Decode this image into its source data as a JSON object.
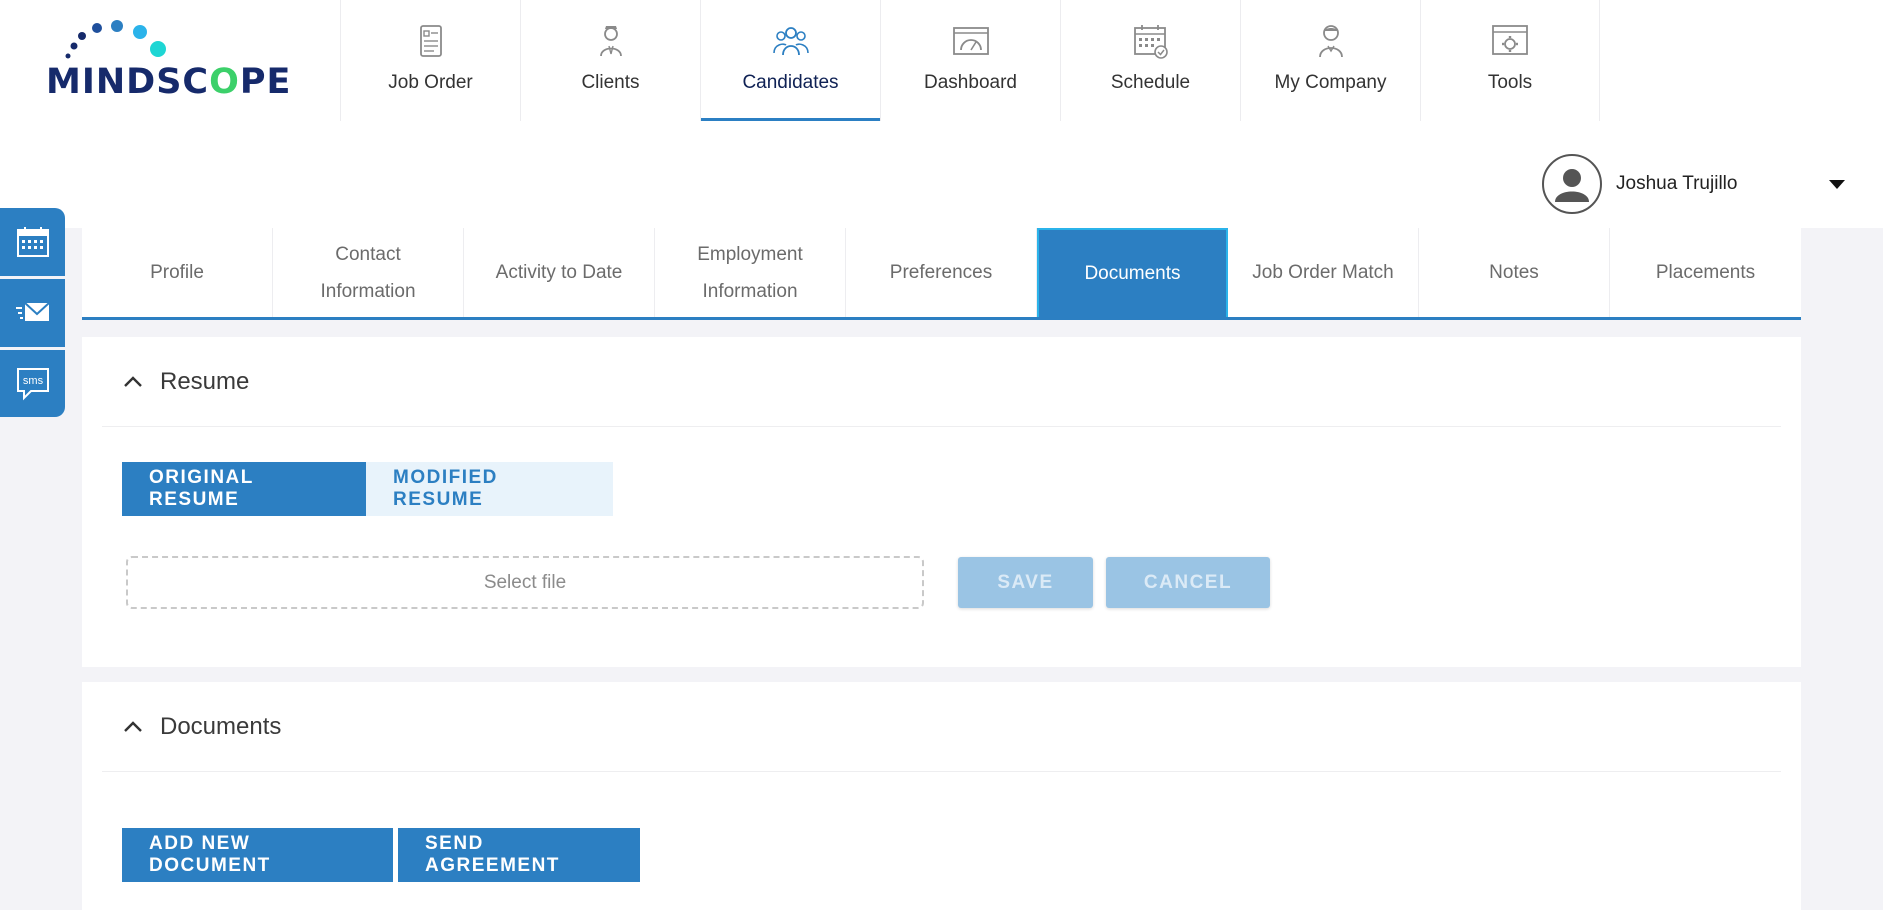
{
  "logo": {
    "text_before": "MINDSC",
    "text_o": "O",
    "text_after": "PE"
  },
  "nav": {
    "items": [
      {
        "label": "Job Order",
        "icon": "job-order-icon"
      },
      {
        "label": "Clients",
        "icon": "clients-icon"
      },
      {
        "label": "Candidates",
        "icon": "candidates-icon",
        "active": true
      },
      {
        "label": "Dashboard",
        "icon": "dashboard-icon"
      },
      {
        "label": "Schedule",
        "icon": "schedule-icon"
      },
      {
        "label": "My Company",
        "icon": "my-company-icon"
      },
      {
        "label": "Tools",
        "icon": "tools-icon"
      }
    ]
  },
  "user": {
    "name": "Joshua Trujillo"
  },
  "sidebar": {
    "items": [
      {
        "icon": "calendar-icon"
      },
      {
        "icon": "email-icon"
      },
      {
        "icon": "sms-icon",
        "text": "sms"
      }
    ]
  },
  "tabs": [
    {
      "line1": "Profile",
      "line2": ""
    },
    {
      "line1": "Contact",
      "line2": "Information"
    },
    {
      "line1": "Activity to Date",
      "line2": ""
    },
    {
      "line1": "Employment",
      "line2": "Information"
    },
    {
      "line1": "Preferences",
      "line2": ""
    },
    {
      "line1": "Documents",
      "line2": "",
      "active": true
    },
    {
      "line1": "Job Order Match",
      "line2": ""
    },
    {
      "line1": "Notes",
      "line2": ""
    },
    {
      "line1": "Placements",
      "line2": ""
    }
  ],
  "resume": {
    "title": "Resume",
    "original_label": "ORIGINAL RESUME",
    "modified_label": "MODIFIED RESUME",
    "file_placeholder": "Select file",
    "save_label": "SAVE",
    "cancel_label": "CANCEL"
  },
  "documents": {
    "title": "Documents",
    "add_label": "ADD NEW DOCUMENT",
    "send_label": "SEND AGREEMENT"
  },
  "colors": {
    "brand_blue": "#2c7fc2",
    "logo_navy": "#162a6b",
    "logo_green": "#3cd06a",
    "accent_cyan": "#2bb3ea"
  }
}
